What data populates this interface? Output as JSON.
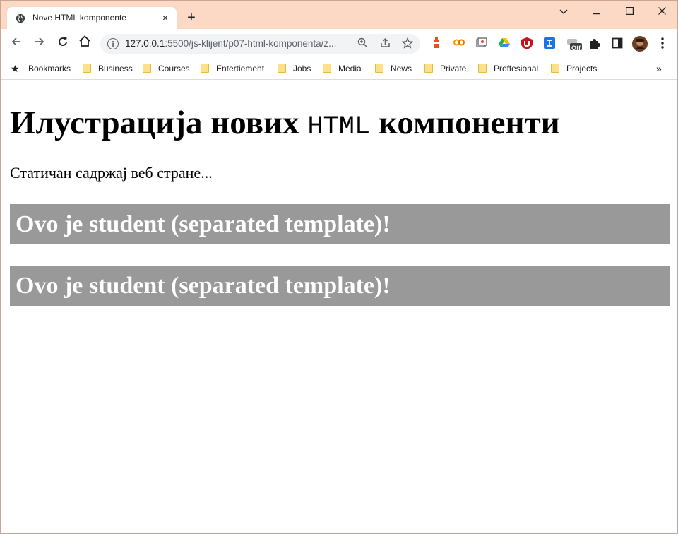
{
  "browser": {
    "tab": {
      "title": "Nove HTML komponente",
      "close": "×"
    },
    "new_tab": "+",
    "window_controls": {
      "dropdown": "⌄",
      "minimize": "─",
      "maximize": "☐",
      "close": "✕"
    },
    "nav": {
      "back": "←",
      "forward": "→",
      "reload": "↻",
      "home": "⌂"
    },
    "address": {
      "host": "127.0.0.1",
      "rest": ":5500/js-klijent/p07-html-komponenta/z..."
    },
    "omnibox_icons": {
      "zoom": "⊕",
      "share": "⇪",
      "star": "☆"
    },
    "extensions": [
      "lighthouse-icon",
      "coupon-icon",
      "tab-icon",
      "drive-icon",
      "ublock-icon",
      "translate-icon",
      "off-icon",
      "puzzle-icon",
      "sidepanel-icon",
      "avatar",
      "menu-icon"
    ],
    "extension_labels": {
      "off": "Off"
    },
    "bookmarks": [
      {
        "label": "Bookmarks"
      },
      {
        "label": "Business"
      },
      {
        "label": "Courses"
      },
      {
        "label": "Entertiement"
      },
      {
        "label": "Jobs"
      },
      {
        "label": "Media"
      },
      {
        "label": "News"
      },
      {
        "label": "Private"
      },
      {
        "label": "Proffesional"
      },
      {
        "label": "Projects"
      }
    ],
    "bookmarks_more": "»"
  },
  "page": {
    "heading_before": "Илустрација нових ",
    "heading_code": "HTML",
    "heading_after": " компоненти",
    "intro": "Статичан садржај веб стране...",
    "students": [
      {
        "text": "Ovo je student (separated template)!"
      },
      {
        "text": "Ovo je student (separated template)!"
      }
    ]
  },
  "colors": {
    "titlebar": "#fcd9c5",
    "student_bg": "#999999",
    "student_text": "#ffffff"
  }
}
